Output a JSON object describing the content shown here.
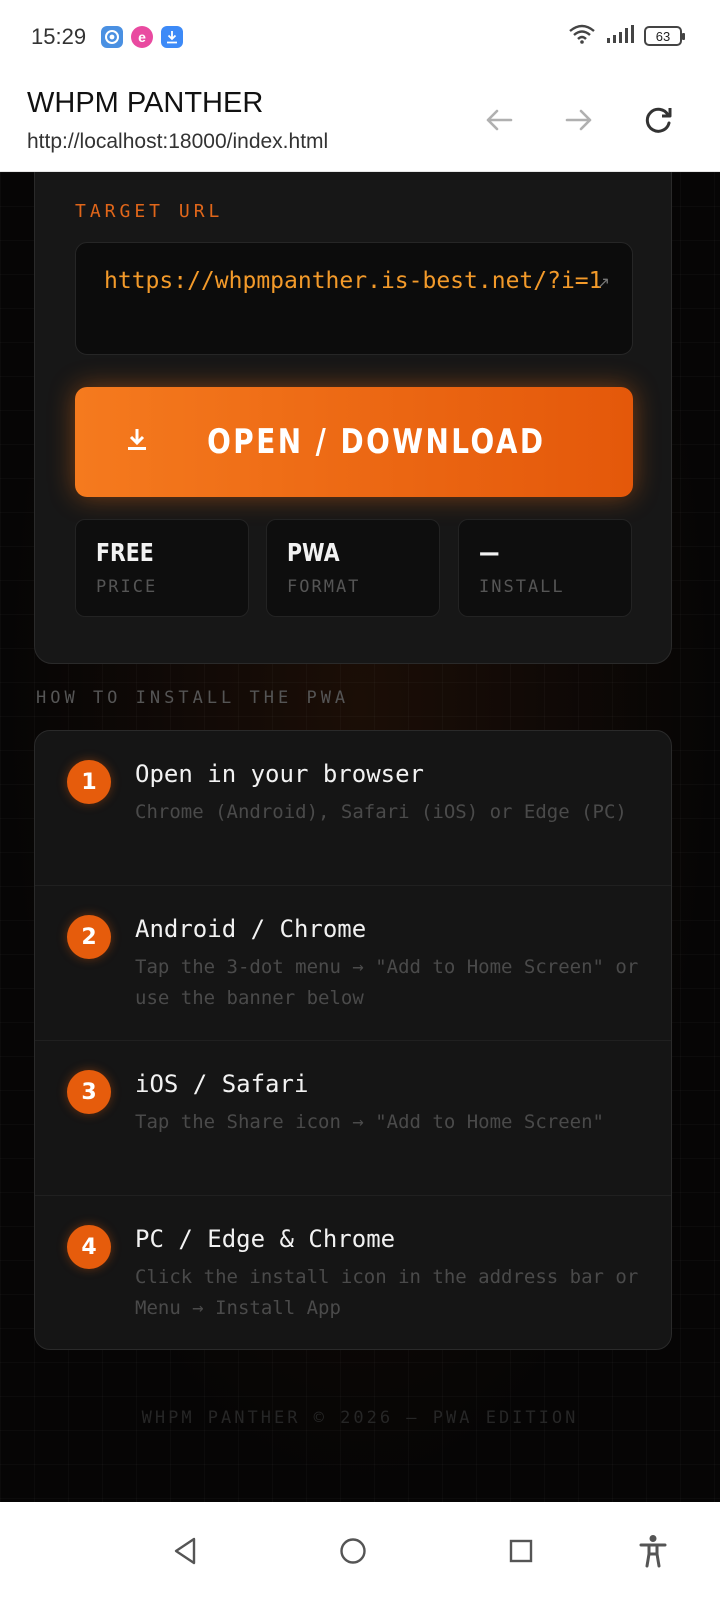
{
  "status_bar": {
    "time": "15:29",
    "notification_icons": [
      "chrome-icon",
      "e-app-icon",
      "download-icon"
    ],
    "battery": "63"
  },
  "browser": {
    "title": "WHPM PANTHER",
    "url": "http://localhost:18000/index.html"
  },
  "target": {
    "label": "TARGET URL",
    "url": "https://whpmpanther.is-best.net/?i=1",
    "link_icon": "↗"
  },
  "open_button": {
    "icon": "⬇",
    "label": "OPEN / DOWNLOAD"
  },
  "stats": [
    {
      "value": "FREE",
      "label": "PRICE"
    },
    {
      "value": "PWA",
      "label": "FORMAT"
    },
    {
      "value": "—",
      "label": "INSTALL"
    }
  ],
  "install": {
    "section_title": "HOW TO INSTALL THE PWA",
    "steps": [
      {
        "num": "1",
        "title": "Open in your browser",
        "desc": "Chrome (Android), Safari (iOS) or Edge (PC)"
      },
      {
        "num": "2",
        "title": "Android / Chrome",
        "desc": "Tap the 3-dot menu → \"Add to Home Screen\" or use the banner below"
      },
      {
        "num": "3",
        "title": "iOS / Safari",
        "desc": "Tap the Share icon → \"Add to Home Screen\""
      },
      {
        "num": "4",
        "title": "PC / Edge & Chrome",
        "desc": "Click the install icon in the address bar or Menu → Install App"
      }
    ]
  },
  "footer": "WHPM PANTHER © 2026 — PWA EDITION",
  "colors": {
    "accent": "#e8620f",
    "url_text": "#f39a2a",
    "background": "#060505",
    "card": "#171717"
  }
}
